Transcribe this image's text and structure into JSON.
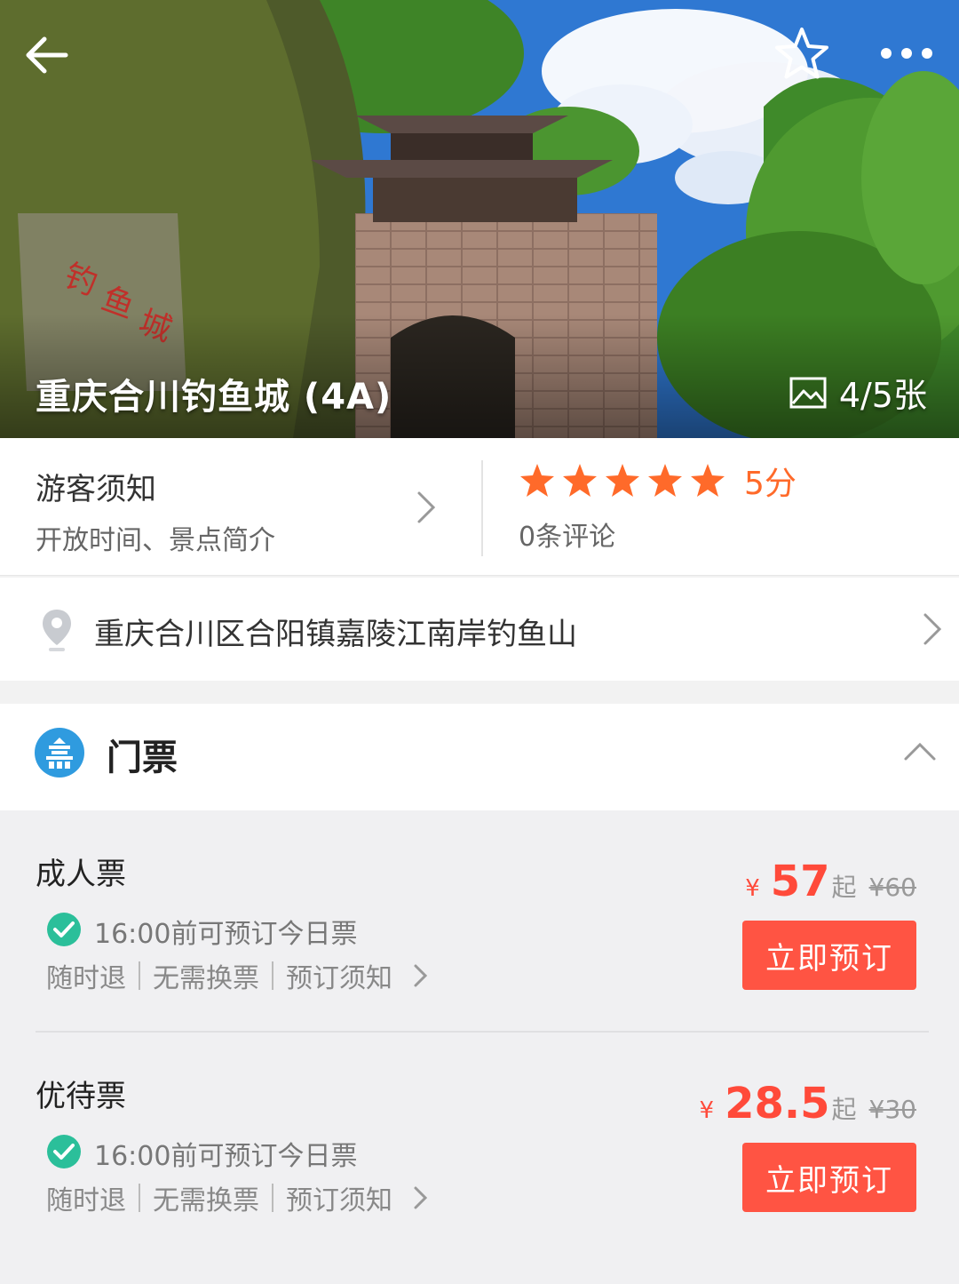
{
  "hero": {
    "title": "重庆合川钓鱼城 (4A)",
    "photo_counter": "4/5张"
  },
  "notice": {
    "title": "游客须知",
    "subtitle": "开放时间、景点简介"
  },
  "rating": {
    "stars": 5,
    "max_stars": 5,
    "score": "5分",
    "reviews": "0条评论",
    "star_color": "#ff6a2a"
  },
  "address": {
    "text": "重庆合川区合阳镇嘉陵江南岸钓鱼山"
  },
  "tickets_section": {
    "title": "门票",
    "icon_color": "#2f9bdf",
    "tickets": [
      {
        "name": "成人票",
        "availability": "16:00前可预订今日票",
        "tags": [
          "随时退",
          "无需换票",
          "预订须知"
        ],
        "currency": "¥",
        "price": "57",
        "from": "起",
        "original_price": "¥60",
        "button": "立即预订"
      },
      {
        "name": "优待票",
        "availability": "16:00前可预订今日票",
        "tags": [
          "随时退",
          "无需换票",
          "预订须知"
        ],
        "currency": "¥",
        "price": "28.5",
        "from": "起",
        "original_price": "¥30",
        "button": "立即预订"
      }
    ]
  },
  "colors": {
    "accent": "#ff5443",
    "check": "#2bbf9a"
  }
}
